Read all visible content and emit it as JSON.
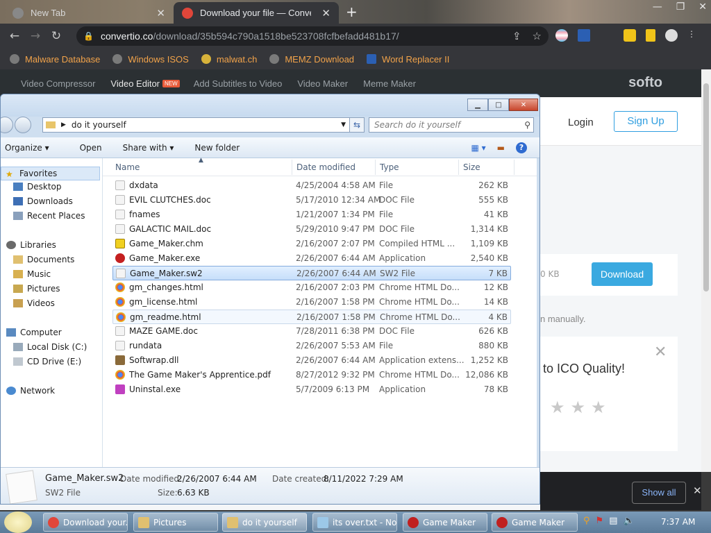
{
  "browser": {
    "tabs": [
      {
        "title": "New Tab"
      },
      {
        "title": "Download your file — Convertio"
      }
    ],
    "address": {
      "host": "convertio.co",
      "path": "/download/35b594c790a1518be523708fcfbefadd481b17/"
    },
    "bookmarks": [
      "Malware Database",
      "Windows ISOS",
      "malwat.ch",
      "MEMZ Download",
      "Word Replacer II"
    ]
  },
  "site": {
    "subnav": [
      "Video Compressor",
      "Video Editor",
      "Add Subtitles to Video",
      "Video Maker",
      "Meme Maker"
    ],
    "new_badge": "NEW",
    "brand": "softo",
    "login": "Login",
    "signup": "Sign Up",
    "size_text": "0 KB",
    "download": "Download",
    "manual_text": "n manually.",
    "quality_text": "to ICO Quality!",
    "stars": "★★★",
    "show_all": "Show all"
  },
  "explorer": {
    "breadcrumb": "do it yourself",
    "search_placeholder": "Search do it yourself",
    "toolbar": {
      "organize": "Organize ▾",
      "open": "Open",
      "share": "Share with ▾",
      "new_folder": "New folder"
    },
    "nav": {
      "favorites": "Favorites",
      "desktop": "Desktop",
      "downloads": "Downloads",
      "recent": "Recent Places",
      "libraries": "Libraries",
      "documents": "Documents",
      "music": "Music",
      "pictures": "Pictures",
      "videos": "Videos",
      "computer": "Computer",
      "local_disk": "Local Disk (C:)",
      "cd_drive": "CD Drive (E:)",
      "network": "Network"
    },
    "columns": {
      "name": "Name",
      "date": "Date modified",
      "type": "Type",
      "size": "Size"
    },
    "files": [
      {
        "name": "dxdata",
        "date": "4/25/2004 4:58 AM",
        "type": "File",
        "size": "262 KB"
      },
      {
        "name": "EVIL CLUTCHES.doc",
        "date": "5/17/2010 12:34 AM",
        "type": "DOC File",
        "size": "555 KB"
      },
      {
        "name": "fnames",
        "date": "1/21/2007 1:34 PM",
        "type": "File",
        "size": "41 KB"
      },
      {
        "name": "GALACTIC MAIL.doc",
        "date": "5/29/2010 9:47 PM",
        "type": "DOC File",
        "size": "1,314 KB"
      },
      {
        "name": "Game_Maker.chm",
        "date": "2/16/2007 2:07 PM",
        "type": "Compiled HTML ...",
        "size": "1,109 KB"
      },
      {
        "name": "Game_Maker.exe",
        "date": "2/26/2007 6:44 AM",
        "type": "Application",
        "size": "2,540 KB"
      },
      {
        "name": "Game_Maker.sw2",
        "date": "2/26/2007 6:44 AM",
        "type": "SW2 File",
        "size": "7 KB"
      },
      {
        "name": "gm_changes.html",
        "date": "2/16/2007 2:03 PM",
        "type": "Chrome HTML Do...",
        "size": "12 KB"
      },
      {
        "name": "gm_license.html",
        "date": "2/16/2007 1:58 PM",
        "type": "Chrome HTML Do...",
        "size": "14 KB"
      },
      {
        "name": "gm_readme.html",
        "date": "2/16/2007 1:58 PM",
        "type": "Chrome HTML Do...",
        "size": "4 KB"
      },
      {
        "name": "MAZE GAME.doc",
        "date": "7/28/2011 6:38 PM",
        "type": "DOC File",
        "size": "626 KB"
      },
      {
        "name": "rundata",
        "date": "2/26/2007 5:53 AM",
        "type": "File",
        "size": "880 KB"
      },
      {
        "name": "Softwrap.dll",
        "date": "2/26/2007 6:44 AM",
        "type": "Application extens...",
        "size": "1,252 KB"
      },
      {
        "name": "The Game Maker's Apprentice.pdf",
        "date": "8/27/2012 9:32 PM",
        "type": "Chrome HTML Do...",
        "size": "12,086 KB"
      },
      {
        "name": "Uninstal.exe",
        "date": "5/7/2009 6:13 PM",
        "type": "Application",
        "size": "78 KB"
      }
    ],
    "details": {
      "name": "Game_Maker.sw2",
      "type": "SW2 File",
      "modified_label": "Date modified:",
      "modified": "2/26/2007 6:44 AM",
      "created_label": "Date created:",
      "created": "8/11/2022 7:29 AM",
      "size_label": "Size:",
      "size": "6.63 KB"
    }
  },
  "taskbar": {
    "items": [
      "Download your...",
      "Pictures",
      "do it yourself",
      "its over.txt - No...",
      "Game Maker",
      "Game Maker"
    ],
    "time": "7:37 AM"
  }
}
